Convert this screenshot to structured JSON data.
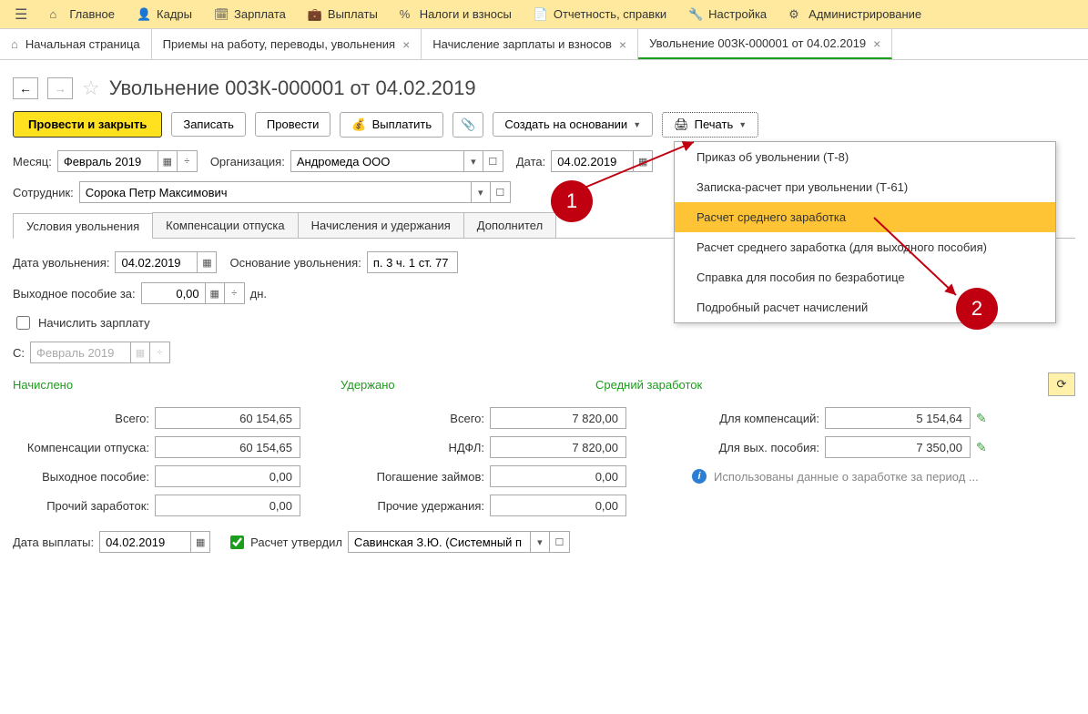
{
  "menu": {
    "items": [
      {
        "icon": "hamburger",
        "label": ""
      },
      {
        "icon": "home",
        "label": "Главное"
      },
      {
        "icon": "people",
        "label": "Кадры"
      },
      {
        "icon": "calc",
        "label": "Зарплата"
      },
      {
        "icon": "wallet",
        "label": "Выплаты"
      },
      {
        "icon": "percent",
        "label": "Налоги и взносы"
      },
      {
        "icon": "doc",
        "label": "Отчетность, справки"
      },
      {
        "icon": "wrench",
        "label": "Настройка"
      },
      {
        "icon": "gears",
        "label": "Администрирование"
      }
    ]
  },
  "tabs": [
    {
      "label": "Начальная страница",
      "closable": false,
      "home": true
    },
    {
      "label": "Приемы на работу, переводы, увольнения",
      "closable": true
    },
    {
      "label": "Начисление зарплаты и взносов",
      "closable": true
    },
    {
      "label": "Увольнение 00ЗК-000001 от 04.02.2019",
      "closable": true,
      "active": true
    }
  ],
  "title": "Увольнение 00ЗК-000001 от 04.02.2019",
  "toolbar": {
    "post_close": "Провести и закрыть",
    "save": "Записать",
    "post": "Провести",
    "pay": "Выплатить",
    "create_based": "Создать на основании",
    "print": "Печать"
  },
  "header": {
    "month_label": "Месяц:",
    "month_value": "Февраль 2019",
    "org_label": "Организация:",
    "org_value": "Андромеда ООО",
    "date_label": "Дата:",
    "date_value": "04.02.2019",
    "employee_label": "Сотрудник:",
    "employee_value": "Сорока Петр Максимович"
  },
  "content_tabs": [
    "Условия увольнения",
    "Компенсации отпуска",
    "Начисления и удержания",
    "Дополнител"
  ],
  "dismissal": {
    "date_label": "Дата увольнения:",
    "date_value": "04.02.2019",
    "basis_label": "Основание увольнения:",
    "basis_value": "п. 3 ч. 1 ст. 77",
    "severance_label": "Выходное пособие за:",
    "severance_value": "0,00",
    "severance_days": "дн.",
    "accrue_salary": "Начислить зарплату",
    "from_label": "С:",
    "from_value": "Февраль 2019"
  },
  "sections": {
    "accrued": "Начислено",
    "withheld": "Удержано",
    "avg_earn": "Средний заработок"
  },
  "calc": {
    "total_label": "Всего:",
    "accrued_total": "60 154,65",
    "vacation_comp_label": "Компенсации отпуска:",
    "vacation_comp": "60 154,65",
    "severance_label": "Выходное пособие:",
    "severance": "0,00",
    "other_income_label": "Прочий заработок:",
    "other_income": "0,00",
    "withheld_total": "7 820,00",
    "ndfl_label": "НДФЛ:",
    "ndfl": "7 820,00",
    "loan_label": "Погашение займов:",
    "loan": "0,00",
    "other_withheld_label": "Прочие удержания:",
    "other_withheld": "0,00",
    "comp_avg_label": "Для компенсаций:",
    "comp_avg": "5 154,64",
    "sev_avg_label": "Для вых. пособия:",
    "sev_avg": "7 350,00",
    "info_text": "Использованы данные о заработке за период ..."
  },
  "footer": {
    "pay_date_label": "Дата выплаты:",
    "pay_date_value": "04.02.2019",
    "approved_label": "Расчет утвердил",
    "approved_by": "Савинская З.Ю. (Системный п"
  },
  "print_menu": [
    "Приказ об увольнении (Т-8)",
    "Записка-расчет при увольнении (Т-61)",
    "Расчет среднего заработка",
    "Расчет среднего заработка (для выходного пособия)",
    "Справка для пособия по безработице",
    "Подробный расчет начислений"
  ],
  "callouts": {
    "c1": "1",
    "c2": "2"
  }
}
